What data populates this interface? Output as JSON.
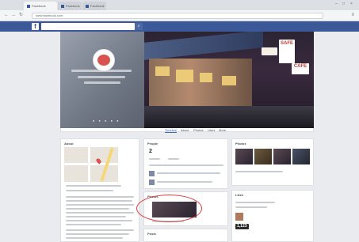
{
  "browser": {
    "tabs": [
      {
        "label": "Facebook",
        "active": true
      },
      {
        "label": "Facebook",
        "active": false
      },
      {
        "label": "Facebook",
        "active": false
      }
    ],
    "address": "www.facebook.com"
  },
  "fb_header": {
    "logo": "f",
    "search_value": "",
    "right_nav": ""
  },
  "cover": {
    "dots": "● ● ● ● ●",
    "signs": [
      "SAFE",
      "CAFE"
    ]
  },
  "page_tabs": [
    "Timeline",
    "About",
    "Photos",
    "Likes",
    "More"
  ],
  "cards": {
    "about": {
      "title": "About"
    },
    "people": {
      "title": "People",
      "count": "2"
    },
    "photos": {
      "title": "Photos"
    },
    "recent_photos": {
      "title": "Photos"
    },
    "visitor_posts": {
      "title": "Visitor Posts"
    },
    "likes": {
      "title": "Likes"
    },
    "posts": {
      "title": "Posts"
    }
  },
  "badges": "1,123"
}
